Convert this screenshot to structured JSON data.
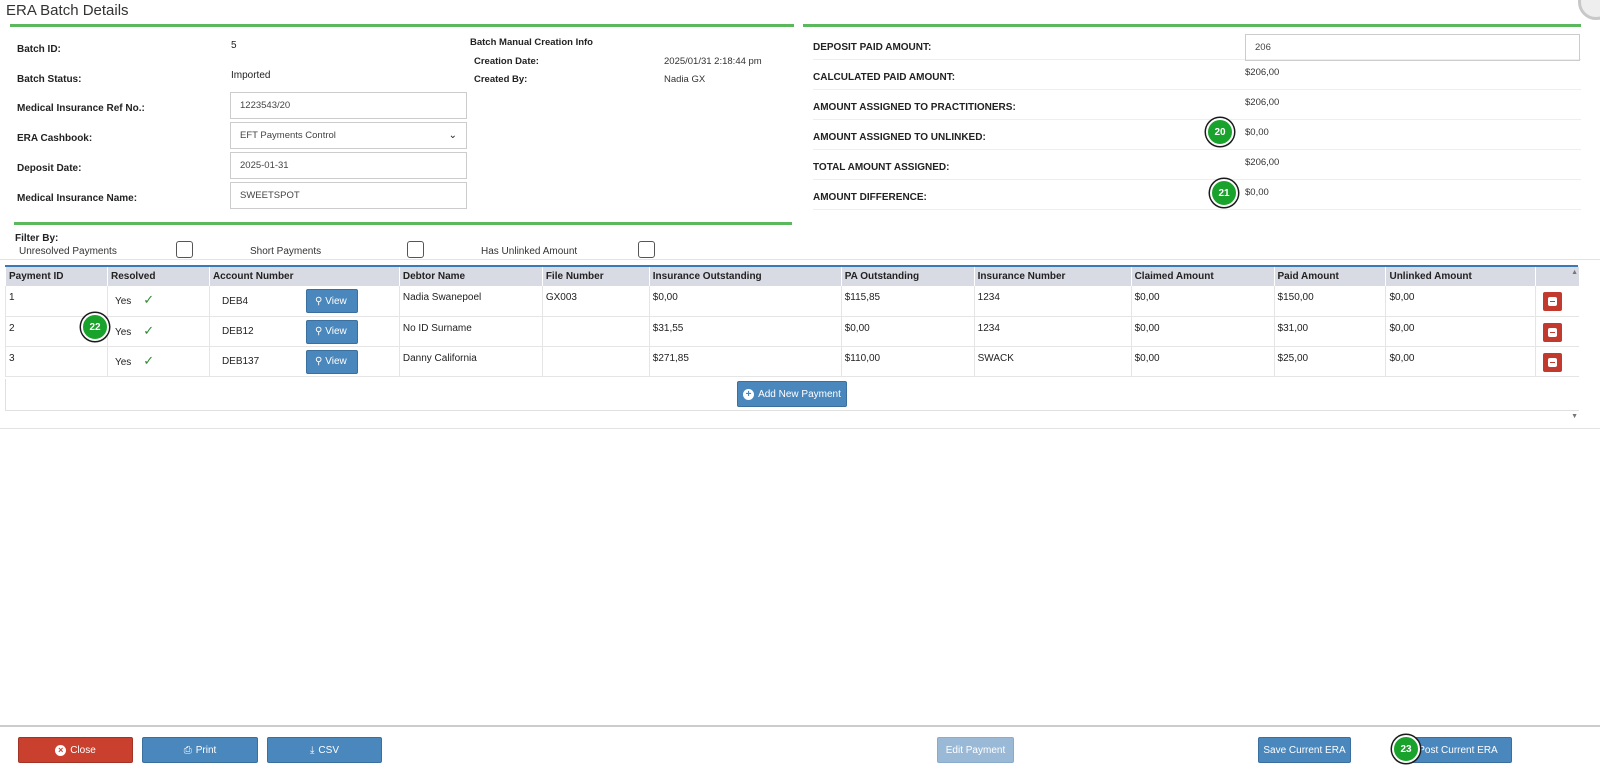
{
  "page": {
    "title": "ERA Batch Details"
  },
  "batch": {
    "fields": [
      {
        "label": "Batch ID:",
        "value": "5"
      },
      {
        "label": "Batch Status:",
        "value": "Imported"
      },
      {
        "label": "Medical Insurance Ref No.:",
        "value": "1223543/20"
      },
      {
        "label": "ERA Cashbook:",
        "value": "EFT Payments Control"
      },
      {
        "label": "Deposit Date:",
        "value": "2025-01-31"
      },
      {
        "label": "Medical Insurance Name:",
        "value": "SWEETSPOT"
      }
    ],
    "manual_creation": {
      "title": "Batch Manual Creation Info",
      "creation_date_label": "Creation Date:",
      "creation_date": "2025/01/31 2:18:44 pm",
      "created_by_label": "Created By:",
      "created_by": "Nadia GX"
    }
  },
  "amounts": {
    "rows": [
      {
        "label": "DEPOSIT PAID AMOUNT:",
        "value": "206"
      },
      {
        "label": "CALCULATED PAID AMOUNT:",
        "value": "$206,00"
      },
      {
        "label": "AMOUNT ASSIGNED TO PRACTITIONERS:",
        "value": "$206,00"
      },
      {
        "label": "AMOUNT ASSIGNED TO UNLINKED:",
        "value": "$0,00"
      },
      {
        "label": "TOTAL AMOUNT ASSIGNED:",
        "value": "$206,00"
      },
      {
        "label": "AMOUNT DIFFERENCE:",
        "value": "$0,00"
      }
    ]
  },
  "filter": {
    "header": "Filter By:",
    "options": [
      "Unresolved Payments",
      "Short Payments",
      "Has Unlinked Amount"
    ]
  },
  "table": {
    "columns": [
      "Payment ID",
      "Resolved",
      "Account Number",
      "Debtor Name",
      "File Number",
      "Insurance Outstanding",
      "PA Outstanding",
      "Insurance Number",
      "Claimed Amount",
      "Paid Amount",
      "Unlinked Amount",
      ""
    ],
    "view_label": "View",
    "rows": [
      {
        "id": "1",
        "resolved": "Yes",
        "account": "DEB4",
        "debtor": "Nadia Swanepoel",
        "file": "GX003",
        "ins_out": "$0,00",
        "pa_out": "$115,85",
        "ins_num": "1234",
        "claimed": "$0,00",
        "paid": "$150,00",
        "unlinked": "$0,00"
      },
      {
        "id": "2",
        "resolved": "Yes",
        "account": "DEB12",
        "debtor": "No ID Surname",
        "file": "",
        "ins_out": "$31,55",
        "pa_out": "$0,00",
        "ins_num": "1234",
        "claimed": "$0,00",
        "paid": "$31,00",
        "unlinked": "$0,00"
      },
      {
        "id": "3",
        "resolved": "Yes",
        "account": "DEB137",
        "debtor": "Danny California",
        "file": "",
        "ins_out": "$271,85",
        "pa_out": "$110,00",
        "ins_num": "SWACK",
        "claimed": "$0,00",
        "paid": "$25,00",
        "unlinked": "$0,00"
      }
    ],
    "add_label": "Add New Payment"
  },
  "badges": {
    "b20": "20",
    "b21": "21",
    "b22": "22",
    "b23": "23"
  },
  "footer": {
    "close": "Close",
    "print": "Print",
    "csv": "CSV",
    "edit_payment": "Edit Payment",
    "save": "Save Current ERA",
    "post": "Post Current ERA"
  }
}
